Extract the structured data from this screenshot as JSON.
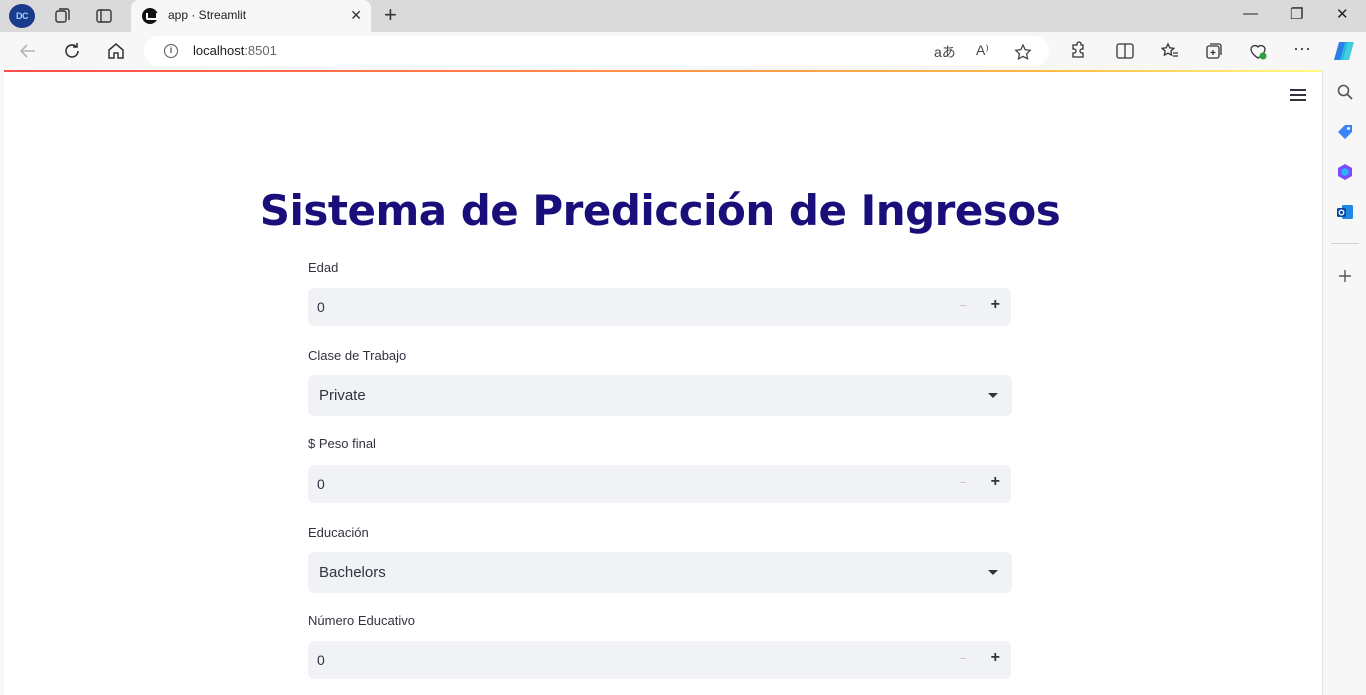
{
  "browser": {
    "profile_initials": "DC",
    "tab_title": "app · Streamlit",
    "url_host": "localhost",
    "url_port": ":8501",
    "translate_label": "aあ",
    "read_aloud_label": "A⁾"
  },
  "app": {
    "title": "Sistema de Predicción de Ingresos",
    "fields": [
      {
        "label": "Edad",
        "value": "0",
        "kind": "number"
      },
      {
        "label": "Clase de Trabajo",
        "value": "Private",
        "kind": "select"
      },
      {
        "label": "$ Peso final",
        "value": "0",
        "kind": "number"
      },
      {
        "label": "Educación",
        "value": "Bachelors",
        "kind": "select"
      },
      {
        "label": "Número Educativo",
        "value": "0",
        "kind": "number"
      }
    ],
    "stepper_minus": "−",
    "stepper_plus": "+"
  },
  "colors": {
    "title": "#1a0f7a",
    "input_bg": "#f0f2f6",
    "accent_gradient_start": "#ff4b4b",
    "accent_gradient_end": "#fffd80"
  }
}
